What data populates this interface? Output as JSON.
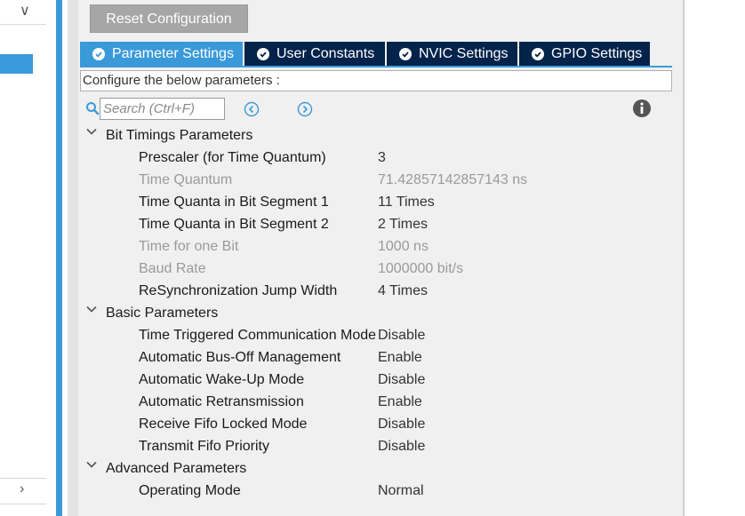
{
  "toolbar": {
    "reset_label": "Reset Configuration"
  },
  "tabs": [
    {
      "label": "Parameter Settings",
      "active": true
    },
    {
      "label": "User Constants",
      "active": false
    },
    {
      "label": "NVIC Settings",
      "active": false
    },
    {
      "label": "GPIO Settings",
      "active": false
    }
  ],
  "configure_label": "Configure the below parameters :",
  "search": {
    "placeholder": "Search (Ctrl+F)"
  },
  "groups": [
    {
      "title": "Bit Timings Parameters",
      "params": [
        {
          "name": "Prescaler (for Time Quantum)",
          "value": "3",
          "readonly": false
        },
        {
          "name": "Time Quantum",
          "value": "71.42857142857143 ns",
          "readonly": true
        },
        {
          "name": "Time Quanta in Bit Segment 1",
          "value": "11 Times",
          "readonly": false
        },
        {
          "name": "Time Quanta in Bit Segment 2",
          "value": "2 Times",
          "readonly": false
        },
        {
          "name": "Time for one Bit",
          "value": "1000 ns",
          "readonly": true
        },
        {
          "name": "Baud Rate",
          "value": "1000000 bit/s",
          "readonly": true
        },
        {
          "name": "ReSynchronization Jump Width",
          "value": "4 Times",
          "readonly": false
        }
      ]
    },
    {
      "title": "Basic Parameters",
      "params": [
        {
          "name": "Time Triggered Communication Mode",
          "value": "Disable",
          "readonly": false
        },
        {
          "name": "Automatic Bus-Off Management",
          "value": "Enable",
          "readonly": false
        },
        {
          "name": "Automatic Wake-Up Mode",
          "value": "Disable",
          "readonly": false
        },
        {
          "name": "Automatic Retransmission",
          "value": "Enable",
          "readonly": false
        },
        {
          "name": "Receive Fifo Locked Mode",
          "value": "Disable",
          "readonly": false
        },
        {
          "name": "Transmit Fifo Priority",
          "value": "Disable",
          "readonly": false
        }
      ]
    },
    {
      "title": "Advanced Parameters",
      "params": [
        {
          "name": "Operating Mode",
          "value": "Normal",
          "readonly": false
        }
      ]
    }
  ],
  "colors": {
    "accent": "#3a9ad9",
    "tab_inactive": "#03234b",
    "button_gray": "#a6a6a6",
    "readonly_text": "#9a9a9a"
  }
}
